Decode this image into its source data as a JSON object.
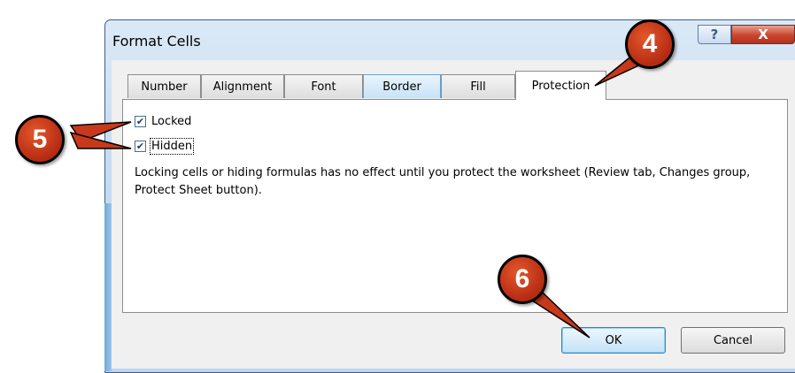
{
  "window": {
    "title": "Format Cells",
    "help_glyph": "?",
    "close_glyph": "X"
  },
  "tabs": [
    {
      "label": "Number"
    },
    {
      "label": "Alignment"
    },
    {
      "label": "Font"
    },
    {
      "label": "Border"
    },
    {
      "label": "Fill"
    },
    {
      "label": "Protection"
    }
  ],
  "active_tab": "Protection",
  "protection": {
    "locked": {
      "label": "Locked",
      "checked": true
    },
    "hidden": {
      "label": "Hidden",
      "checked": true
    },
    "description": "Locking cells or hiding formulas has no effect until you protect the worksheet (Review tab, Changes group, Protect Sheet button)."
  },
  "buttons": {
    "ok": "OK",
    "cancel": "Cancel"
  },
  "callouts": {
    "four": "4",
    "five": "5",
    "six": "6"
  },
  "colors": {
    "callout_fill": "#c8381a",
    "title_bar": "#c5dcf1",
    "close_button": "#c9452d"
  }
}
